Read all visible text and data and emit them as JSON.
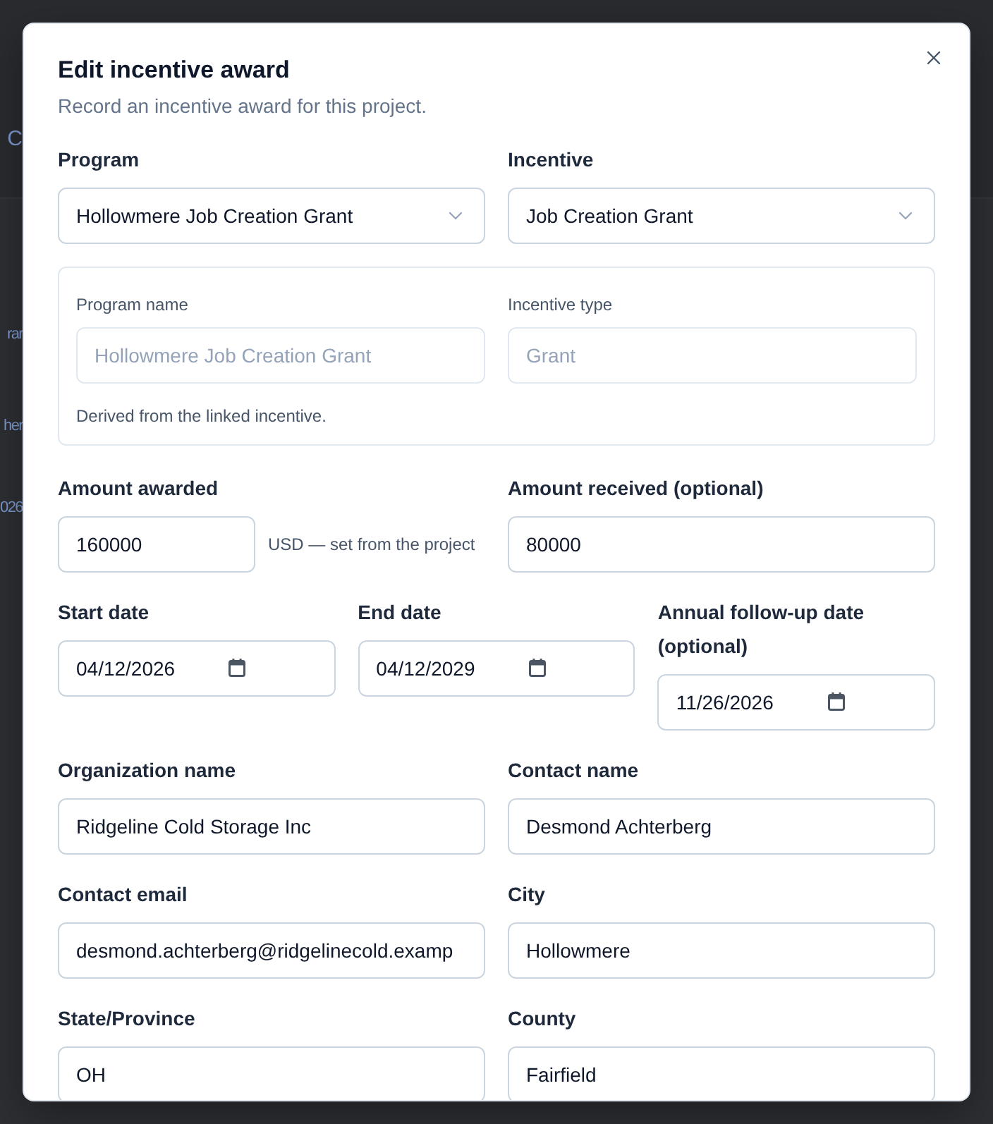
{
  "background_page": {
    "header_text": "C",
    "row_texts": [
      "rar",
      "her",
      "026"
    ]
  },
  "dialog": {
    "title": "Edit incentive award",
    "description": "Record an incentive award for this project.",
    "sections": [
      {
        "kind": "fields",
        "fields": [
          {
            "kind": "select",
            "label": "Program",
            "value": "Hollowmere Job Creation Grant"
          },
          {
            "kind": "select",
            "label": "Incentive",
            "value": "Job Creation Grant"
          }
        ]
      },
      {
        "kind": "derived",
        "fields": [
          {
            "label": "Program name",
            "value": "Hollowmere Job Creation Grant",
            "disabled": true
          },
          {
            "label": "Incentive type",
            "value": "Grant",
            "disabled": true
          }
        ],
        "note": "Derived from the linked incentive."
      },
      {
        "kind": "fields",
        "fields": [
          {
            "kind": "amount",
            "label": "Amount awarded",
            "value": "160000",
            "hint": "USD — set from the project"
          },
          {
            "kind": "text",
            "label": "Amount received (optional)",
            "value": "80000"
          }
        ]
      },
      {
        "kind": "fields",
        "fields": [
          {
            "kind": "date",
            "label": "Start date",
            "value": "04/12/2026"
          },
          {
            "kind": "date",
            "label": "End date",
            "value": "04/12/2029"
          },
          {
            "kind": "date",
            "label": "Annual follow-up date (optional)",
            "value": "11/26/2026"
          }
        ]
      },
      {
        "kind": "fields",
        "fields": [
          {
            "kind": "text",
            "label": "Organization name",
            "value": "Ridgeline Cold Storage Inc"
          },
          {
            "kind": "text",
            "label": "Contact name",
            "value": "Desmond Achterberg"
          }
        ]
      },
      {
        "kind": "fields",
        "fields": [
          {
            "kind": "text",
            "label": "Contact email",
            "value": "desmond.achterberg@ridgelinecold.examp"
          },
          {
            "kind": "text",
            "label": "City",
            "value": "Hollowmere"
          }
        ]
      },
      {
        "kind": "fields",
        "fields": [
          {
            "kind": "text",
            "label": "State/Province",
            "value": "OH"
          },
          {
            "kind": "text",
            "label": "County",
            "value": "Fairfield"
          }
        ]
      }
    ]
  }
}
